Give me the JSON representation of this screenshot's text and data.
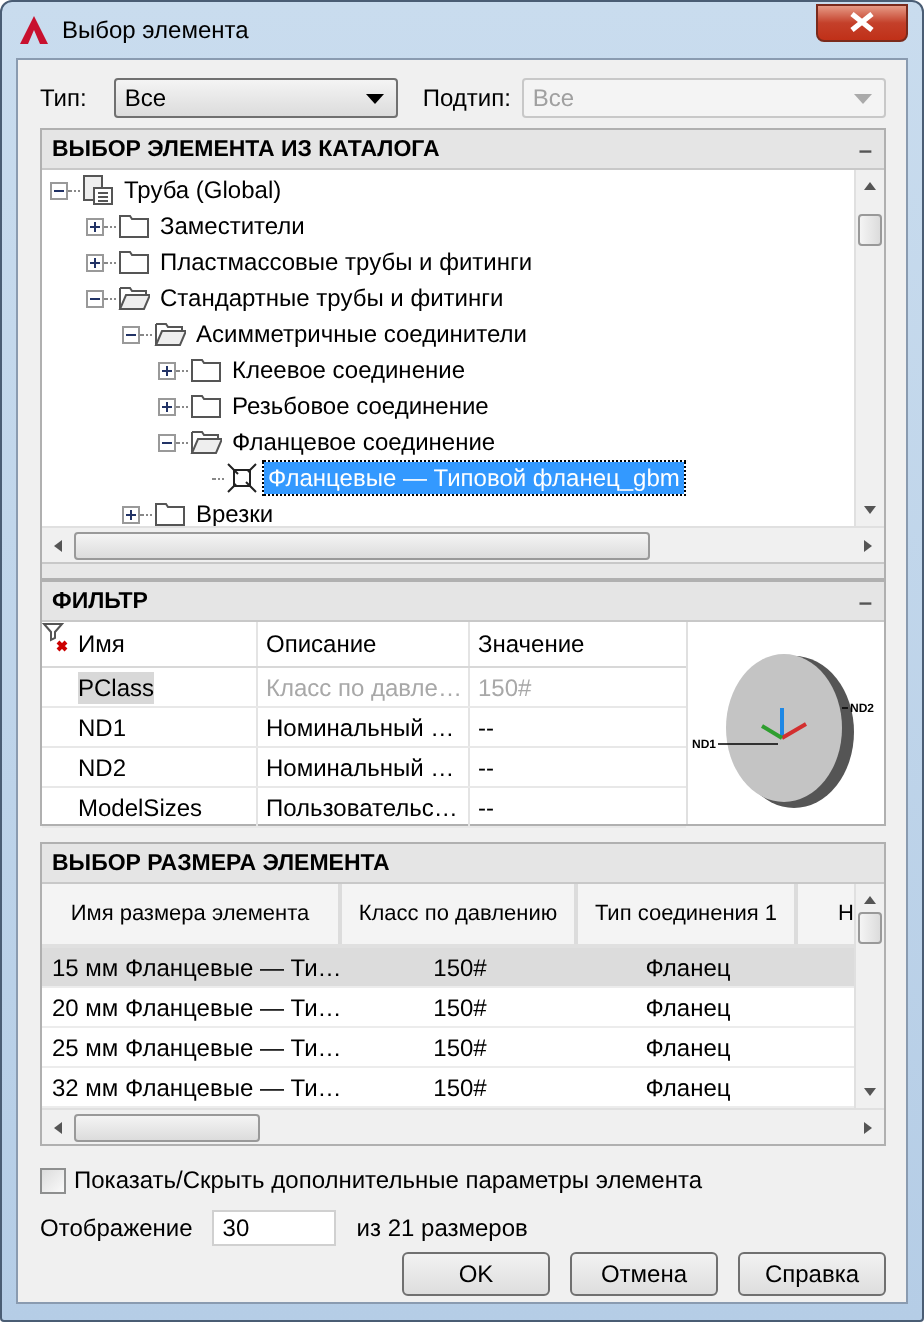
{
  "window": {
    "title": "Выбор элемента"
  },
  "type_row": {
    "type_label": "Тип:",
    "type_value": "Все",
    "subtype_label": "Подтип:",
    "subtype_value": "Все",
    "subtype_disabled": true
  },
  "catalog": {
    "title": "ВЫБОР ЭЛЕМЕНТА ИЗ КАТАЛОГА",
    "collapse": "–",
    "tree": [
      {
        "label": "Труба (Global)",
        "kind": "catalog",
        "expanded": true,
        "selected": false,
        "children": [
          {
            "label": "Заместители",
            "kind": "folder",
            "expanded": false,
            "selected": false
          },
          {
            "label": "Пластмассовые трубы и фитинги",
            "kind": "folder",
            "expanded": false,
            "selected": false
          },
          {
            "label": "Стандартные трубы и фитинги",
            "kind": "folder",
            "expanded": true,
            "selected": false,
            "children": [
              {
                "label": "Асимметричные соединители",
                "kind": "folder",
                "expanded": true,
                "selected": false,
                "children": [
                  {
                    "label": "Клеевое соединение",
                    "kind": "folder",
                    "expanded": false,
                    "selected": false
                  },
                  {
                    "label": "Резьбовое соединение",
                    "kind": "folder",
                    "expanded": false,
                    "selected": false
                  },
                  {
                    "label": "Фланцевое соединение",
                    "kind": "folder",
                    "expanded": true,
                    "selected": false,
                    "children": [
                      {
                        "label": "Фланцевые — Типовой фланец_gbm",
                        "kind": "part",
                        "selected": true
                      }
                    ]
                  }
                ]
              },
              {
                "label": "Врезки",
                "kind": "folder",
                "expanded": false,
                "selected": false
              }
            ]
          }
        ]
      }
    ]
  },
  "filter": {
    "title": "ФИЛЬТР",
    "collapse": "–",
    "columns": [
      "Имя",
      "Описание",
      "Значение"
    ],
    "rows": [
      {
        "name": "PClass",
        "description": "Класс по давле…",
        "value": "150#",
        "disabled": true
      },
      {
        "name": "ND1",
        "description": "Номинальный …",
        "value": "--",
        "disabled": false
      },
      {
        "name": "ND2",
        "description": "Номинальный …",
        "value": "--",
        "disabled": false
      },
      {
        "name": "ModelSizes",
        "description": "Пользовательс…",
        "value": "--",
        "disabled": false
      }
    ],
    "preview": {
      "labels": [
        "ND1",
        "ND2"
      ]
    }
  },
  "sizes": {
    "title": "ВЫБОР РАЗМЕРА ЭЛЕМЕНТА",
    "columns": [
      "Имя размера элемента",
      "Класс по давлению",
      "Тип соединения 1",
      "Н"
    ],
    "rows": [
      {
        "cells": [
          "15 мм Фланцевые — Ти…",
          "150#",
          "Фланец"
        ],
        "selected": true
      },
      {
        "cells": [
          "20 мм Фланцевые — Ти…",
          "150#",
          "Фланец"
        ],
        "selected": false
      },
      {
        "cells": [
          "25 мм Фланцевые — Ти…",
          "150#",
          "Фланец"
        ],
        "selected": false
      },
      {
        "cells": [
          "32 мм Фланцевые — Ти…",
          "150#",
          "Фланец"
        ],
        "selected": false
      }
    ]
  },
  "show_more": {
    "label": "Показать/Скрыть дополнительные параметры элемента",
    "checked": false
  },
  "display": {
    "label": "Отображение",
    "value": "30",
    "suffix": "из 21 размеров"
  },
  "buttons": [
    {
      "label": "OK"
    },
    {
      "label": "Отмена"
    },
    {
      "label": "Справка"
    }
  ]
}
